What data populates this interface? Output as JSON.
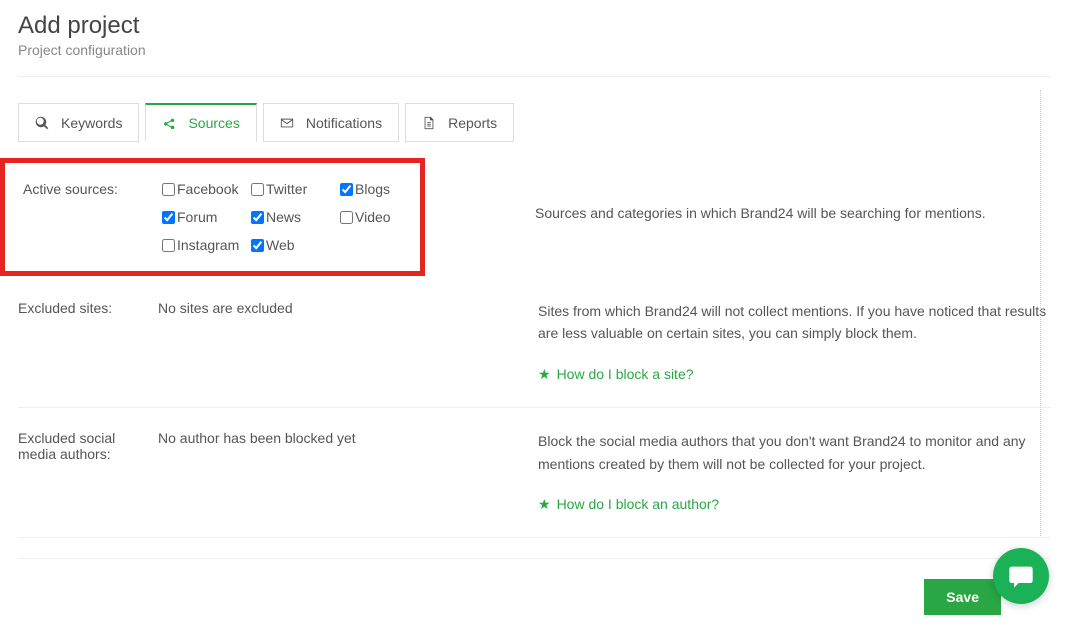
{
  "header": {
    "title": "Add project",
    "subtitle": "Project configuration"
  },
  "tabs": [
    {
      "label": "Keywords",
      "icon": "search"
    },
    {
      "label": "Sources",
      "icon": "share"
    },
    {
      "label": "Notifications",
      "icon": "envelope"
    },
    {
      "label": "Reports",
      "icon": "file"
    }
  ],
  "activeSources": {
    "label": "Active sources:",
    "description": "Sources and categories in which Brand24 will be searching for mentions.",
    "items": [
      {
        "label": "Facebook",
        "checked": false
      },
      {
        "label": "Twitter",
        "checked": false
      },
      {
        "label": "Blogs",
        "checked": true
      },
      {
        "label": "Forum",
        "checked": true
      },
      {
        "label": "News",
        "checked": true
      },
      {
        "label": "Video",
        "checked": false
      },
      {
        "label": "Instagram",
        "checked": false
      },
      {
        "label": "Web",
        "checked": true
      }
    ]
  },
  "excludedSites": {
    "label": "Excluded sites:",
    "value": "No sites are excluded",
    "description": "Sites from which Brand24 will not collect mentions. If you have noticed that results are less valuable on certain sites, you can simply block them.",
    "helpLink": "How do I block a site?"
  },
  "excludedAuthors": {
    "label": "Excluded social media authors:",
    "value": "No author has been blocked yet",
    "description": "Block the social media authors that you don't want Brand24 to monitor and any mentions created by them will not be collected for your project.",
    "helpLink": "How do I block an author?"
  },
  "footer": {
    "saveLabel": "Save"
  }
}
